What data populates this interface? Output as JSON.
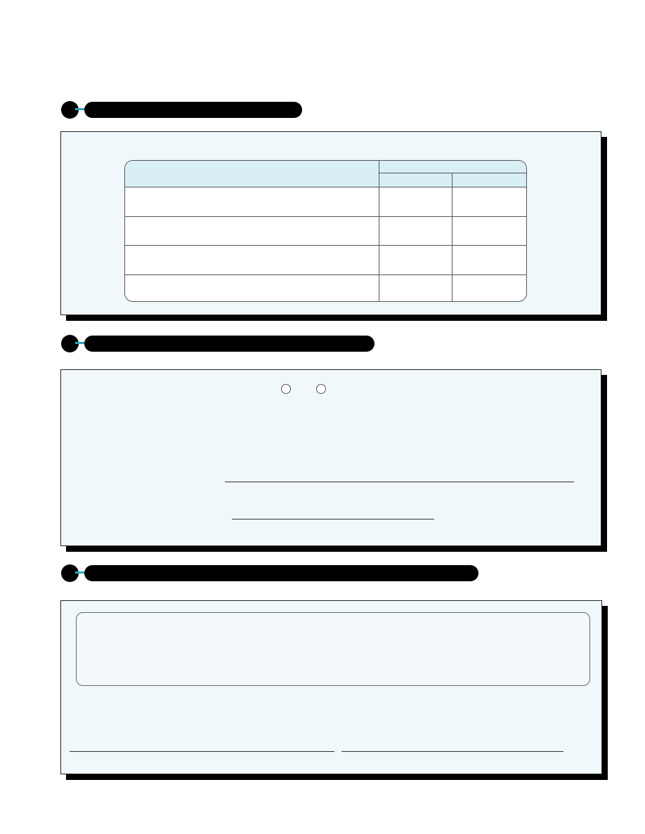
{
  "sections": [
    {
      "number": "",
      "title": ""
    },
    {
      "number": "",
      "title": ""
    },
    {
      "number": "",
      "title": ""
    }
  ],
  "table": {
    "header_label": "",
    "group_header": "",
    "col1_header": "",
    "col2_header": "",
    "rows": [
      {
        "label": "",
        "v1": "",
        "v2": ""
      },
      {
        "label": "",
        "v1": "",
        "v2": ""
      },
      {
        "label": "",
        "v1": "",
        "v2": ""
      },
      {
        "label": "",
        "v1": "",
        "v2": ""
      }
    ]
  },
  "section2": {
    "option_yes": "",
    "option_no": "",
    "field1_value": "",
    "field2_value": ""
  },
  "section3": {
    "statement": "",
    "signature_value": "",
    "date_value": ""
  }
}
